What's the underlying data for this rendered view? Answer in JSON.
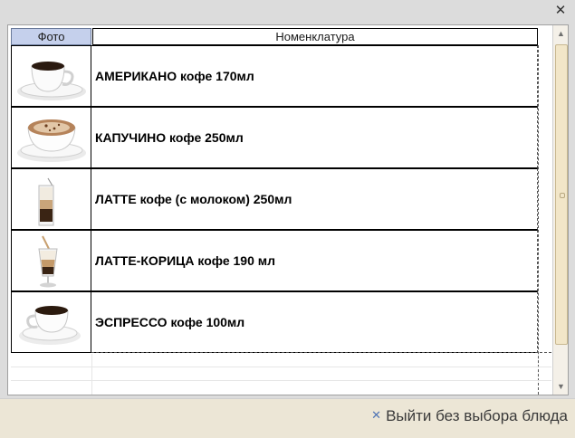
{
  "window": {
    "close_icon": "close-icon"
  },
  "table": {
    "headers": {
      "photo": "Фото",
      "name": "Номенклатура"
    },
    "rows": [
      {
        "name": "АМЕРИКАНО кофе 170мл",
        "photo_icon": "coffee-cup-americano-photo"
      },
      {
        "name": "КАПУЧИНО кофе 250мл",
        "photo_icon": "cappuccino-cup-photo"
      },
      {
        "name": "ЛАТТЕ кофе (с молоком) 250мл",
        "photo_icon": "latte-glass-photo"
      },
      {
        "name": "ЛАТТЕ-КОРИЦА кофе 190 мл",
        "photo_icon": "latte-cinnamon-glass-photo"
      },
      {
        "name": "ЭСПРЕССО кофе 100мл",
        "photo_icon": "espresso-cup-photo"
      }
    ]
  },
  "footer": {
    "exit_label": "Выйти без выбора блюда",
    "exit_icon": "x-icon"
  },
  "colors": {
    "header_photo_bg": "#c5d0ec",
    "footer_bg": "#ece6d6",
    "exit_icon": "#4f74b5"
  }
}
